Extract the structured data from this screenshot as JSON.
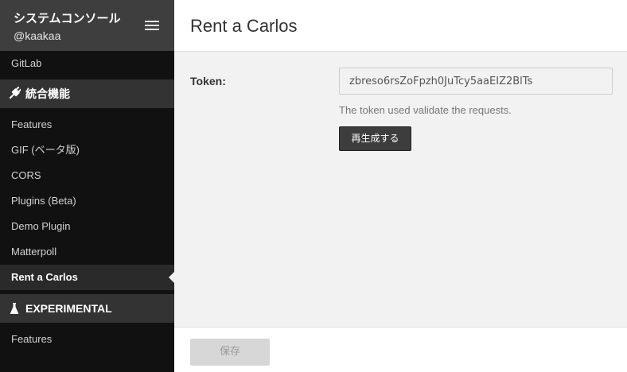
{
  "sidebar": {
    "header": {
      "title": "システムコンソール",
      "username": "@kaakaa",
      "menu_icon": "hamburger-icon"
    },
    "items_top": [
      {
        "label": "GitLab",
        "active": false
      }
    ],
    "sections": [
      {
        "title": "統合機能",
        "icon": "plug-icon",
        "items": [
          {
            "label": "Features",
            "active": false
          },
          {
            "label": "GIF (ベータ版)",
            "active": false
          },
          {
            "label": "CORS",
            "active": false
          },
          {
            "label": "Plugins (Beta)",
            "active": false
          },
          {
            "label": "Demo Plugin",
            "active": false
          },
          {
            "label": "Matterpoll",
            "active": false
          },
          {
            "label": "Rent a Carlos",
            "active": true
          }
        ]
      },
      {
        "title": "EXPERIMENTAL",
        "icon": "flask-icon",
        "items": [
          {
            "label": "Features",
            "active": false
          }
        ]
      }
    ]
  },
  "main": {
    "title": "Rent a Carlos",
    "token": {
      "label": "Token:",
      "value": "zbreso6rsZoFpzh0JuTcy5aaEIZ2BlTs",
      "help": "The token used validate the requests.",
      "regenerate_label": "再生成する"
    },
    "footer": {
      "save_label": "保存"
    }
  },
  "colors": {
    "sidebar_bg": "#111111",
    "sidebar_header_bg": "#3e3e3e",
    "section_bg": "#333333",
    "main_bg": "#f2f2f2",
    "button_dark": "#3d3d3d",
    "button_disabled": "#d7d7d7"
  }
}
